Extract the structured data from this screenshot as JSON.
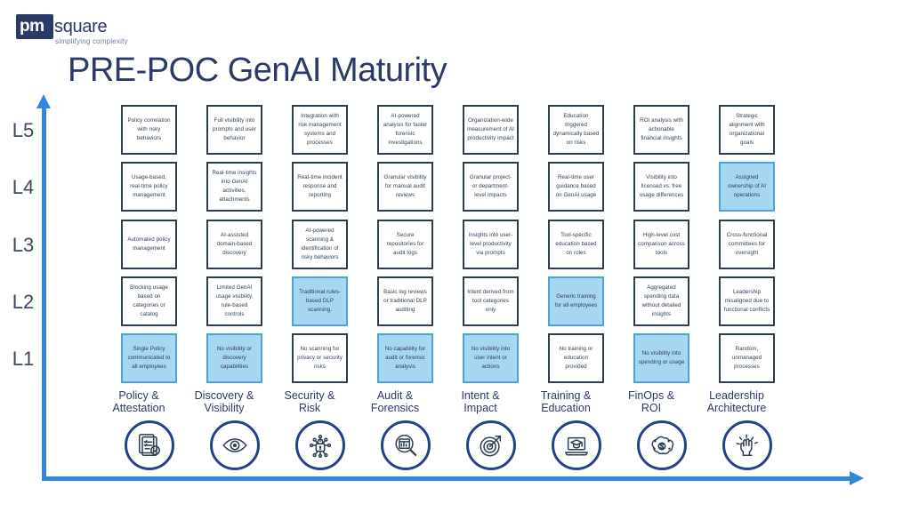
{
  "brand": {
    "mark_text": "pm",
    "word": "square",
    "tagline": "simplifying complexity",
    "logo_color": "#2b3a66"
  },
  "title": "PRE-POC GenAI Maturity",
  "colors": {
    "axis": "#2f88de",
    "cell_border": "#2c3e56",
    "highlight_fill": "#a7d6f2",
    "highlight_border": "#4fa3dd",
    "title": "#2b3a66",
    "icon_ring": "#23438c"
  },
  "axis": {
    "vertical_levels": [
      "L5",
      "L4",
      "L3",
      "L2",
      "L1"
    ],
    "vertical_icon": "arrow-up-icon",
    "horizontal_icon": "arrow-right-icon"
  },
  "columns": [
    {
      "label": "Policy &\nAttestation",
      "icon": "policy-checklist-icon"
    },
    {
      "label": "Discovery &\nVisibility",
      "icon": "eye-icon"
    },
    {
      "label": "Security &\nRisk",
      "icon": "lock-circuit-icon"
    },
    {
      "label": "Audit &\nForensics",
      "icon": "magnifier-report-icon"
    },
    {
      "label": "Intent &\nImpact",
      "icon": "target-arrow-icon"
    },
    {
      "label": "Training &\nEducation",
      "icon": "laptop-graduation-icon"
    },
    {
      "label": "FinOps &\nROI",
      "icon": "brain-dollar-network-icon"
    },
    {
      "label": "Leadership\nArchitecture",
      "icon": "hand-megaphone-icon"
    }
  ],
  "rows": [
    {
      "level": "L5",
      "cells": [
        {
          "text": "Policy correlation with risky behaviors",
          "highlight": false
        },
        {
          "text": "Full visibility into prompts and user behavior",
          "highlight": false
        },
        {
          "text": "Integration with risk management systems and processes",
          "highlight": false
        },
        {
          "text": "AI-powered analysis for faster forensic investigations",
          "highlight": false
        },
        {
          "text": "Organization-wide measurement of AI productivity impact",
          "highlight": false
        },
        {
          "text": "Education triggered dynamically based on risks",
          "highlight": false
        },
        {
          "text": "ROI analysis with actionable financial insights",
          "highlight": false
        },
        {
          "text": "Strategic alignment with organizational goals",
          "highlight": false
        }
      ]
    },
    {
      "level": "L4",
      "cells": [
        {
          "text": "Usage-based, real-time policy management",
          "highlight": false
        },
        {
          "text": "Real-time insights into GenAI activities, attachments",
          "highlight": false
        },
        {
          "text": "Real-time incident response and reporting",
          "highlight": false
        },
        {
          "text": "Granular visibility for manual audit reviews",
          "highlight": false
        },
        {
          "text": "Granular project- or department-level impacts",
          "highlight": false
        },
        {
          "text": "Real-time user guidance based on GenAI usage",
          "highlight": false
        },
        {
          "text": "Visibility into licensed vs. free usage differences",
          "highlight": false
        },
        {
          "text": "Assigned ownership of AI operations",
          "highlight": true
        }
      ]
    },
    {
      "level": "L3",
      "cells": [
        {
          "text": "Automated policy management",
          "highlight": false
        },
        {
          "text": "AI-assisted domain-based discovery",
          "highlight": false
        },
        {
          "text": "AI-powered scanning & identification of risky behaviors",
          "highlight": false
        },
        {
          "text": "Secure repositories for audit logs",
          "highlight": false
        },
        {
          "text": "Insights into user-level productivity via prompts",
          "highlight": false
        },
        {
          "text": "Tool-specific education based on roles",
          "highlight": false
        },
        {
          "text": "High-level cost comparison across tools",
          "highlight": false
        },
        {
          "text": "Cross-functional committees for oversight",
          "highlight": false
        }
      ]
    },
    {
      "level": "L2",
      "cells": [
        {
          "text": "Blocking usage based on categories or catalog",
          "highlight": false
        },
        {
          "text": "Limited GenAI usage visibility, rule-based controls",
          "highlight": false
        },
        {
          "text": "Traditional rules-based DLP scanning.",
          "highlight": true
        },
        {
          "text": "Basic log reviews or traditional DLP auditing",
          "highlight": false
        },
        {
          "text": "Intent derived from tool categories only",
          "highlight": false
        },
        {
          "text": "Generic training for all employees",
          "highlight": true
        },
        {
          "text": "Aggregated spending data without detailed insights",
          "highlight": false
        },
        {
          "text": "Leadership misaligned due to functional conflicts",
          "highlight": false
        }
      ]
    },
    {
      "level": "L1",
      "cells": [
        {
          "text": "Single Policy communicated to all employees",
          "highlight": true
        },
        {
          "text": "No visibility or discovery capabilities",
          "highlight": true
        },
        {
          "text": "No scanning for privacy or security risks",
          "highlight": false
        },
        {
          "text": "No capability for audit or forensic analysis",
          "highlight": true
        },
        {
          "text": "No visibility into user intent or actions",
          "highlight": true
        },
        {
          "text": "No training or education provided",
          "highlight": false
        },
        {
          "text": "No visibility into spending or usage",
          "highlight": true
        },
        {
          "text": "Random, unmanaged processes",
          "highlight": false
        }
      ]
    }
  ]
}
